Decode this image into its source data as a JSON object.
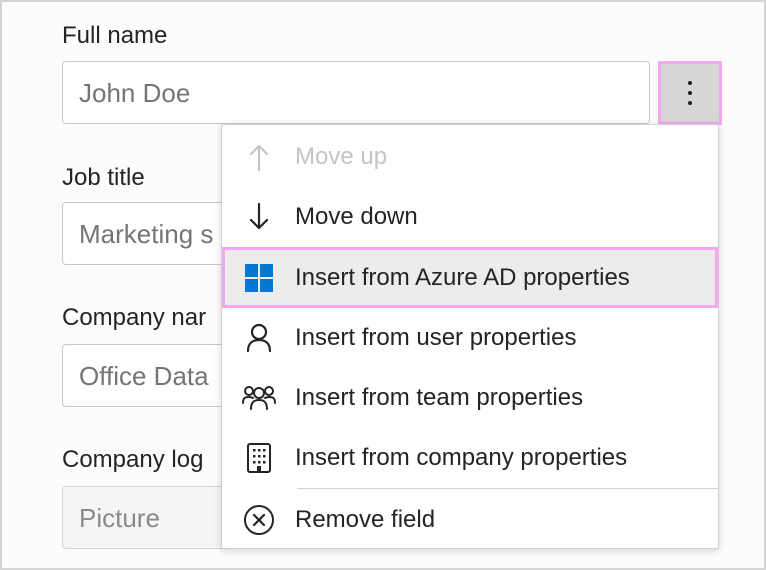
{
  "form": {
    "full_name": {
      "label": "Full name",
      "placeholder": "John Doe"
    },
    "job_title": {
      "label": "Job title",
      "placeholder": "Marketing s"
    },
    "company_name": {
      "label": "Company nar",
      "placeholder": "Office Data"
    },
    "company_logo": {
      "label": "Company log",
      "placeholder": "Picture"
    }
  },
  "more_button": {
    "icon": "more-vertical-icon"
  },
  "menu": {
    "items": [
      {
        "label": "Move up",
        "icon": "arrow-up-icon",
        "disabled": true
      },
      {
        "label": "Move down",
        "icon": "arrow-down-icon"
      },
      {
        "label": "Insert from Azure AD properties",
        "icon": "windows-logo-icon",
        "highlighted": true
      },
      {
        "label": "Insert from user properties",
        "icon": "person-icon"
      },
      {
        "label": "Insert from team properties",
        "icon": "people-team-icon"
      },
      {
        "label": "Insert from company properties",
        "icon": "building-icon"
      },
      {
        "label": "Remove field",
        "icon": "dismiss-circle-icon"
      }
    ]
  },
  "colors": {
    "highlight_border": "#f4a6f0",
    "azure_blue": "#0078d4",
    "disabled_text": "#c4c4c4"
  }
}
